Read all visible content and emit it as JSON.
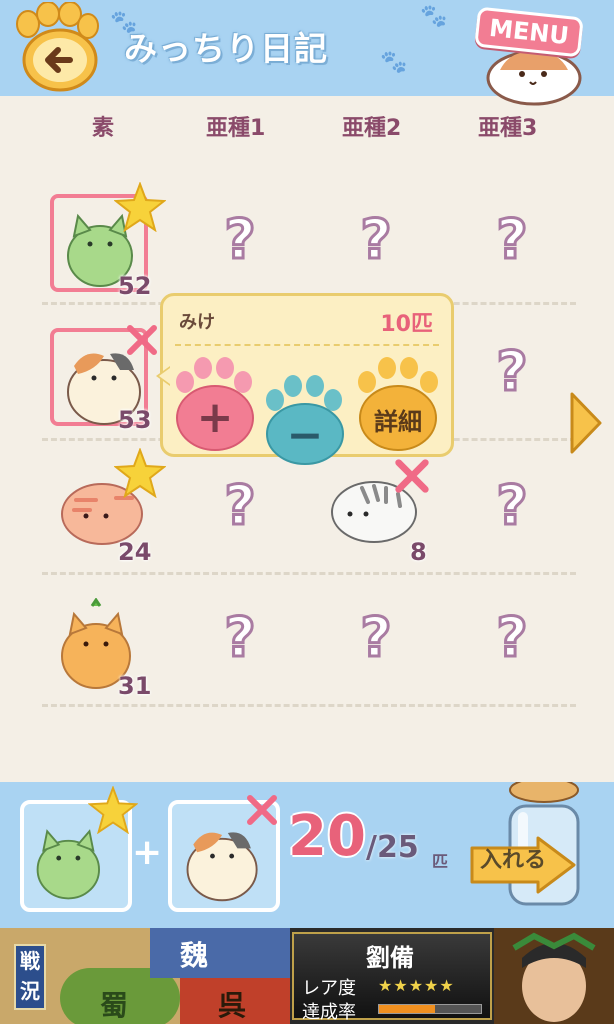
{
  "header": {
    "title": "みっちり日記",
    "menu_label": "MENU"
  },
  "columns": [
    "素",
    "亜種1",
    "亜種2",
    "亜種3"
  ],
  "rows": [
    {
      "base_count": "52",
      "cells": [
        "?",
        "?",
        "?"
      ]
    },
    {
      "base_count": "53",
      "cells": [
        "?",
        "?",
        "?"
      ]
    },
    {
      "base_count": "24",
      "cells": [
        "?",
        "8",
        "?"
      ]
    },
    {
      "base_count": "31",
      "cells": [
        "?",
        "?",
        "?"
      ]
    }
  ],
  "popup": {
    "name": "みけ",
    "count": "10匹",
    "plus_label": "+",
    "minus_label": "−",
    "detail_label": "詳細"
  },
  "bottom": {
    "plus": "+",
    "current": "20",
    "max": "/25",
    "unit": "匹",
    "insert_label": "入れる"
  },
  "ad": {
    "badge": "戦況",
    "kingdoms": [
      "魏",
      "蜀",
      "呉"
    ],
    "hero_name": "劉備",
    "rarity_label": "レア度",
    "rarity_stars": "★★★★★",
    "progress_label": "達成率",
    "progress": 0.55
  },
  "colors": {
    "accent_pink": "#f27d93",
    "sky": "#a9d3f2",
    "cream": "#f4efe6"
  }
}
